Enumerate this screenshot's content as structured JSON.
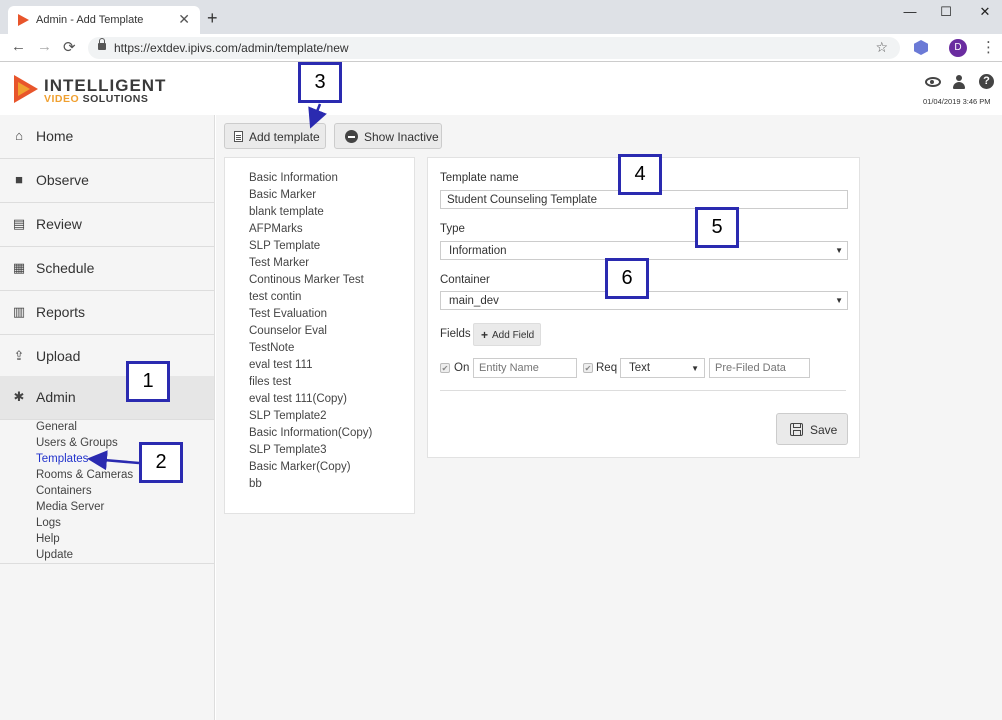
{
  "browser": {
    "tab_title": "Admin - Add Template",
    "tab_close": "✕",
    "new_tab": "+",
    "url": "https://extdev.ipivs.com/admin/template/new",
    "profile_initial": "D",
    "window_buttons": [
      "—",
      "☐",
      "✕"
    ],
    "nav": [
      "←",
      "→",
      "⟳"
    ],
    "star": "☆",
    "kebab": "⋮"
  },
  "header": {
    "logo_line1": "INTELLIGENT",
    "logo_line2_a": "VIDEO",
    "logo_line2_b": "SOLUTIONS",
    "timestamp": "01/04/2019 3:46 PM",
    "help_glyph": "?"
  },
  "sidebar": {
    "items": [
      {
        "label": "Home",
        "icon": "home-icon",
        "glyph": "⌂"
      },
      {
        "label": "Observe",
        "icon": "video-camera-icon",
        "glyph": "■"
      },
      {
        "label": "Review",
        "icon": "film-icon",
        "glyph": "▤"
      },
      {
        "label": "Schedule",
        "icon": "calendar-icon",
        "glyph": "▦"
      },
      {
        "label": "Reports",
        "icon": "bar-chart-icon",
        "glyph": "▥"
      },
      {
        "label": "Upload",
        "icon": "upload-icon",
        "glyph": "⇪"
      },
      {
        "label": "Admin",
        "icon": "gear-icon",
        "glyph": "✱"
      }
    ],
    "admin_subitems": [
      "General",
      "Users & Groups",
      "Templates",
      "Rooms & Cameras",
      "Containers",
      "Media Server",
      "Logs",
      "Help",
      "Update"
    ],
    "active_subitem": "Templates"
  },
  "toolbar": {
    "add_template_label": "Add template",
    "show_inactive_label": "Show Inactive"
  },
  "template_list": [
    "Basic Information",
    "Basic Marker",
    "blank template",
    "AFPMarks",
    "SLP Template",
    "Test Marker",
    "Continous Marker Test",
    "test contin",
    "Test Evaluation",
    "Counselor Eval",
    "TestNote",
    "eval test 111",
    "files test",
    "eval test 111(Copy)",
    "SLP Template2",
    "Basic Information(Copy)",
    "SLP Template3",
    "Basic Marker(Copy)",
    "bb"
  ],
  "form": {
    "template_name_label": "Template name",
    "template_name_value": "Student Counseling Template",
    "type_label": "Type",
    "type_value": "Information",
    "container_label": "Container",
    "container_value": "main_dev",
    "fields_label": "Fields",
    "add_field_label": "Add Field",
    "add_field_glyph": "+",
    "on_label": "On",
    "req_label": "Req",
    "entity_name_placeholder": "Entity Name",
    "field_type_value": "Text",
    "prefilled_placeholder": "Pre-Filed Data",
    "save_label": "Save",
    "check_glyph": "✔",
    "caret_glyph": "▼"
  },
  "callouts": [
    "1",
    "2",
    "3",
    "4",
    "5",
    "6"
  ],
  "colors": {
    "accent_orange": "#e8552b",
    "callout_border": "#2a2ab0",
    "active_link": "#2233cc"
  }
}
